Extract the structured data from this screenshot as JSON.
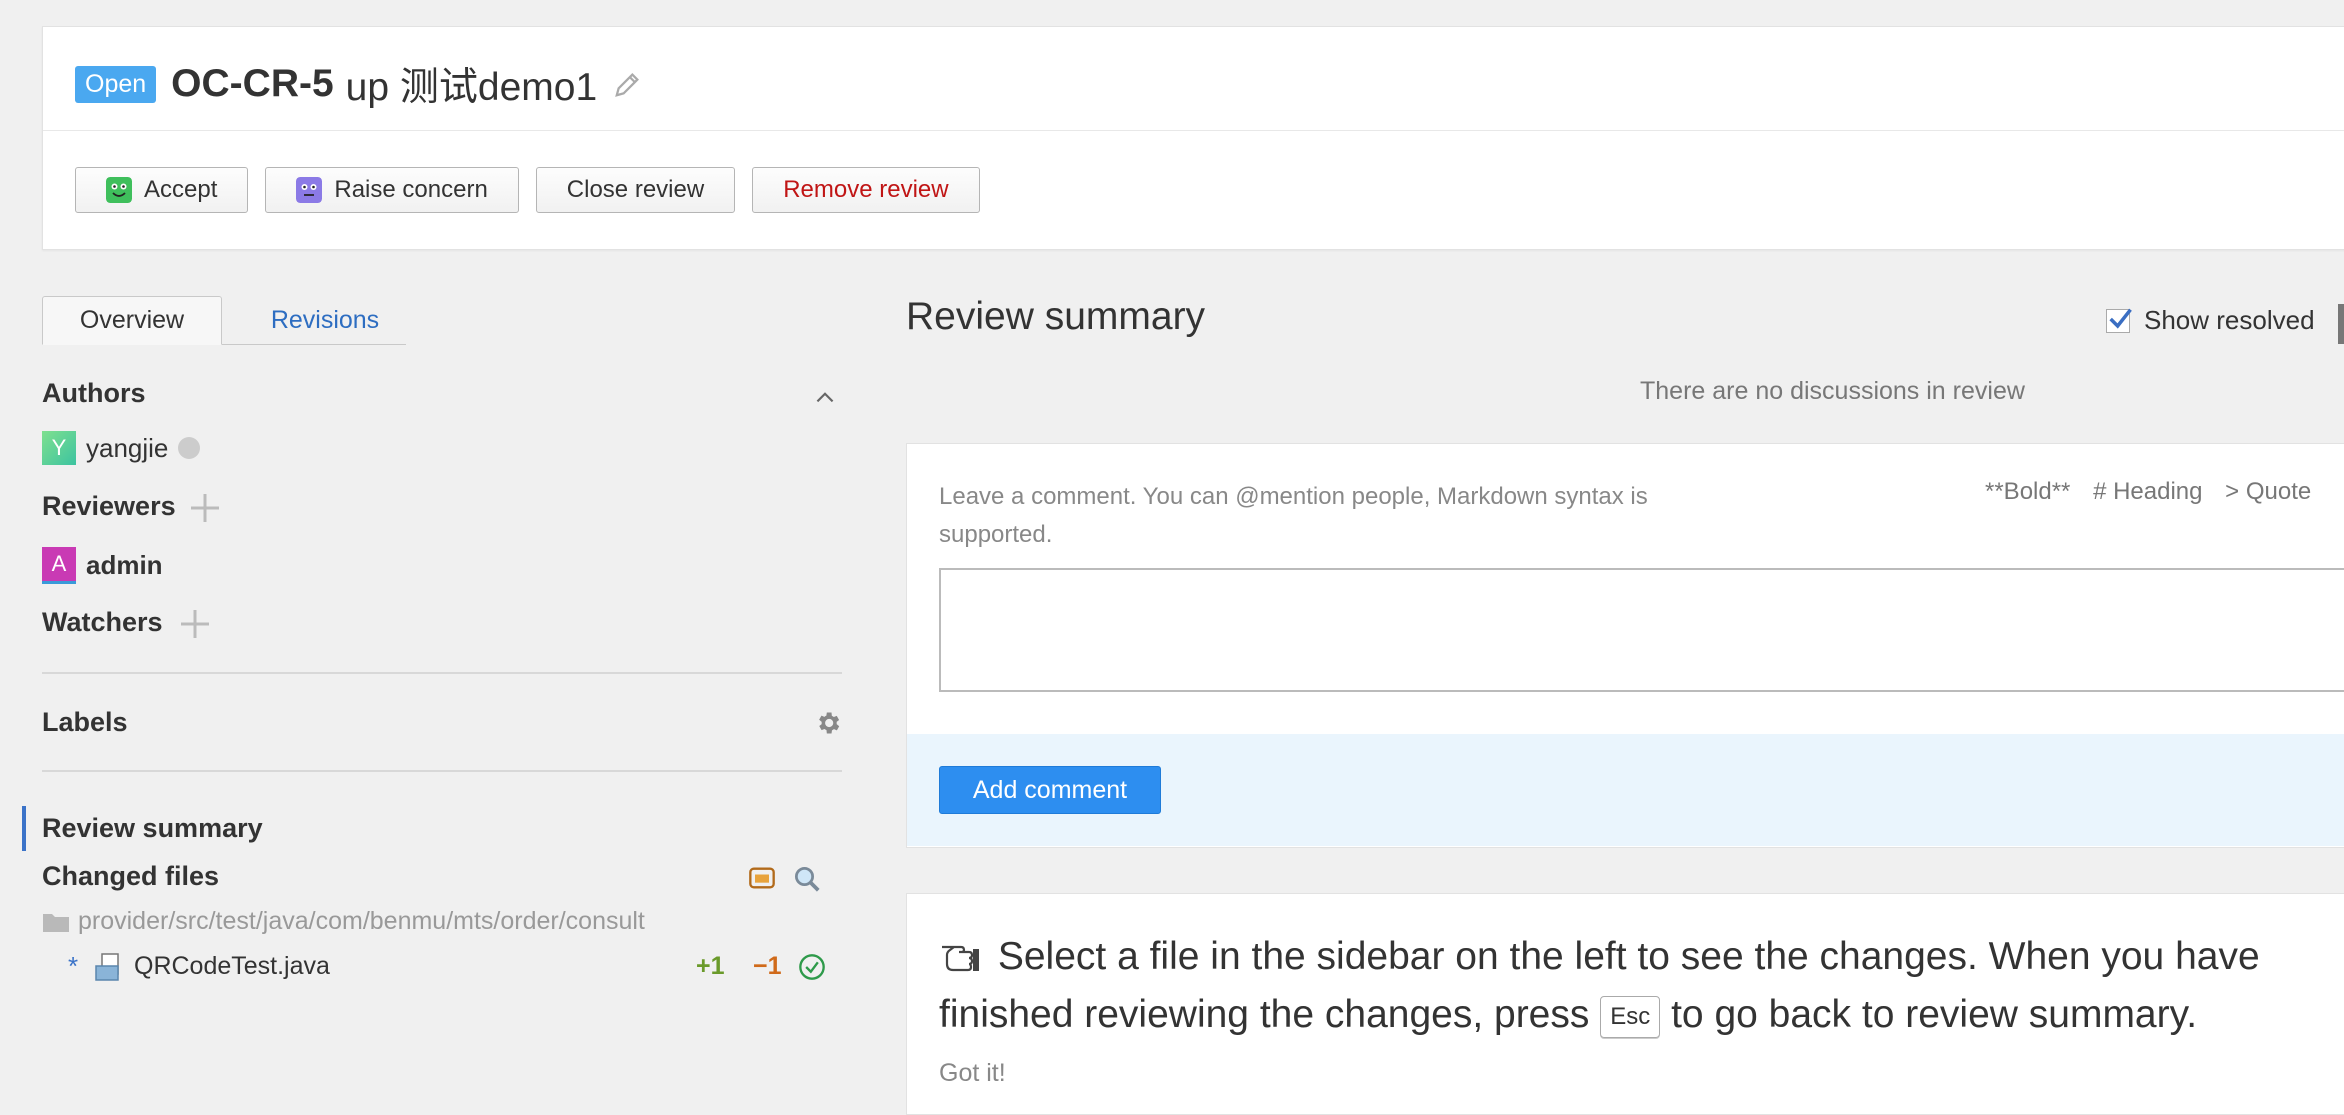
{
  "review": {
    "status": "Open",
    "id": "OC-CR-5",
    "title": "up 测试demo1"
  },
  "actions": {
    "accept": "Accept",
    "raise_concern": "Raise concern",
    "close_review": "Close review",
    "remove_review": "Remove review"
  },
  "tabs": {
    "overview": "Overview",
    "revisions": "Revisions"
  },
  "sidebar": {
    "authors_label": "Authors",
    "author": {
      "initial": "Y",
      "name": "yangjie"
    },
    "reviewers_label": "Reviewers",
    "reviewer": {
      "initial": "A",
      "name": "admin"
    },
    "watchers_label": "Watchers",
    "labels_label": "Labels",
    "review_summary_label": "Review summary",
    "changed_files_label": "Changed files",
    "folder_path": "provider/src/test/java/com/benmu/mts/order/consult",
    "file": {
      "marker": "*",
      "name": "QRCodeTest.java",
      "added": "+1",
      "removed": "−1"
    }
  },
  "main": {
    "title": "Review summary",
    "show_resolved": "Show resolved",
    "no_discussions": "There are no discussions in review",
    "comment_placeholder": "Leave a comment. You can @mention people, Markdown syntax is supported.",
    "md_bold": "**Bold**",
    "md_heading": "# Heading",
    "md_quote": "> Quote",
    "add_comment": "Add comment",
    "tip_part1": "Select a file in the sidebar on the left to see the changes. When you have finished reviewing the changes, press",
    "tip_key": "Esc",
    "tip_part2": "to go back to review summary.",
    "got_it": "Got it!"
  },
  "colors": {
    "accent": "#2d8ef0",
    "open_badge": "#4aa8f0",
    "author_avatar": "#4fc98a",
    "reviewer_avatar": "#c93ab4",
    "added": "#6a9a2a",
    "removed": "#d06a1a"
  }
}
